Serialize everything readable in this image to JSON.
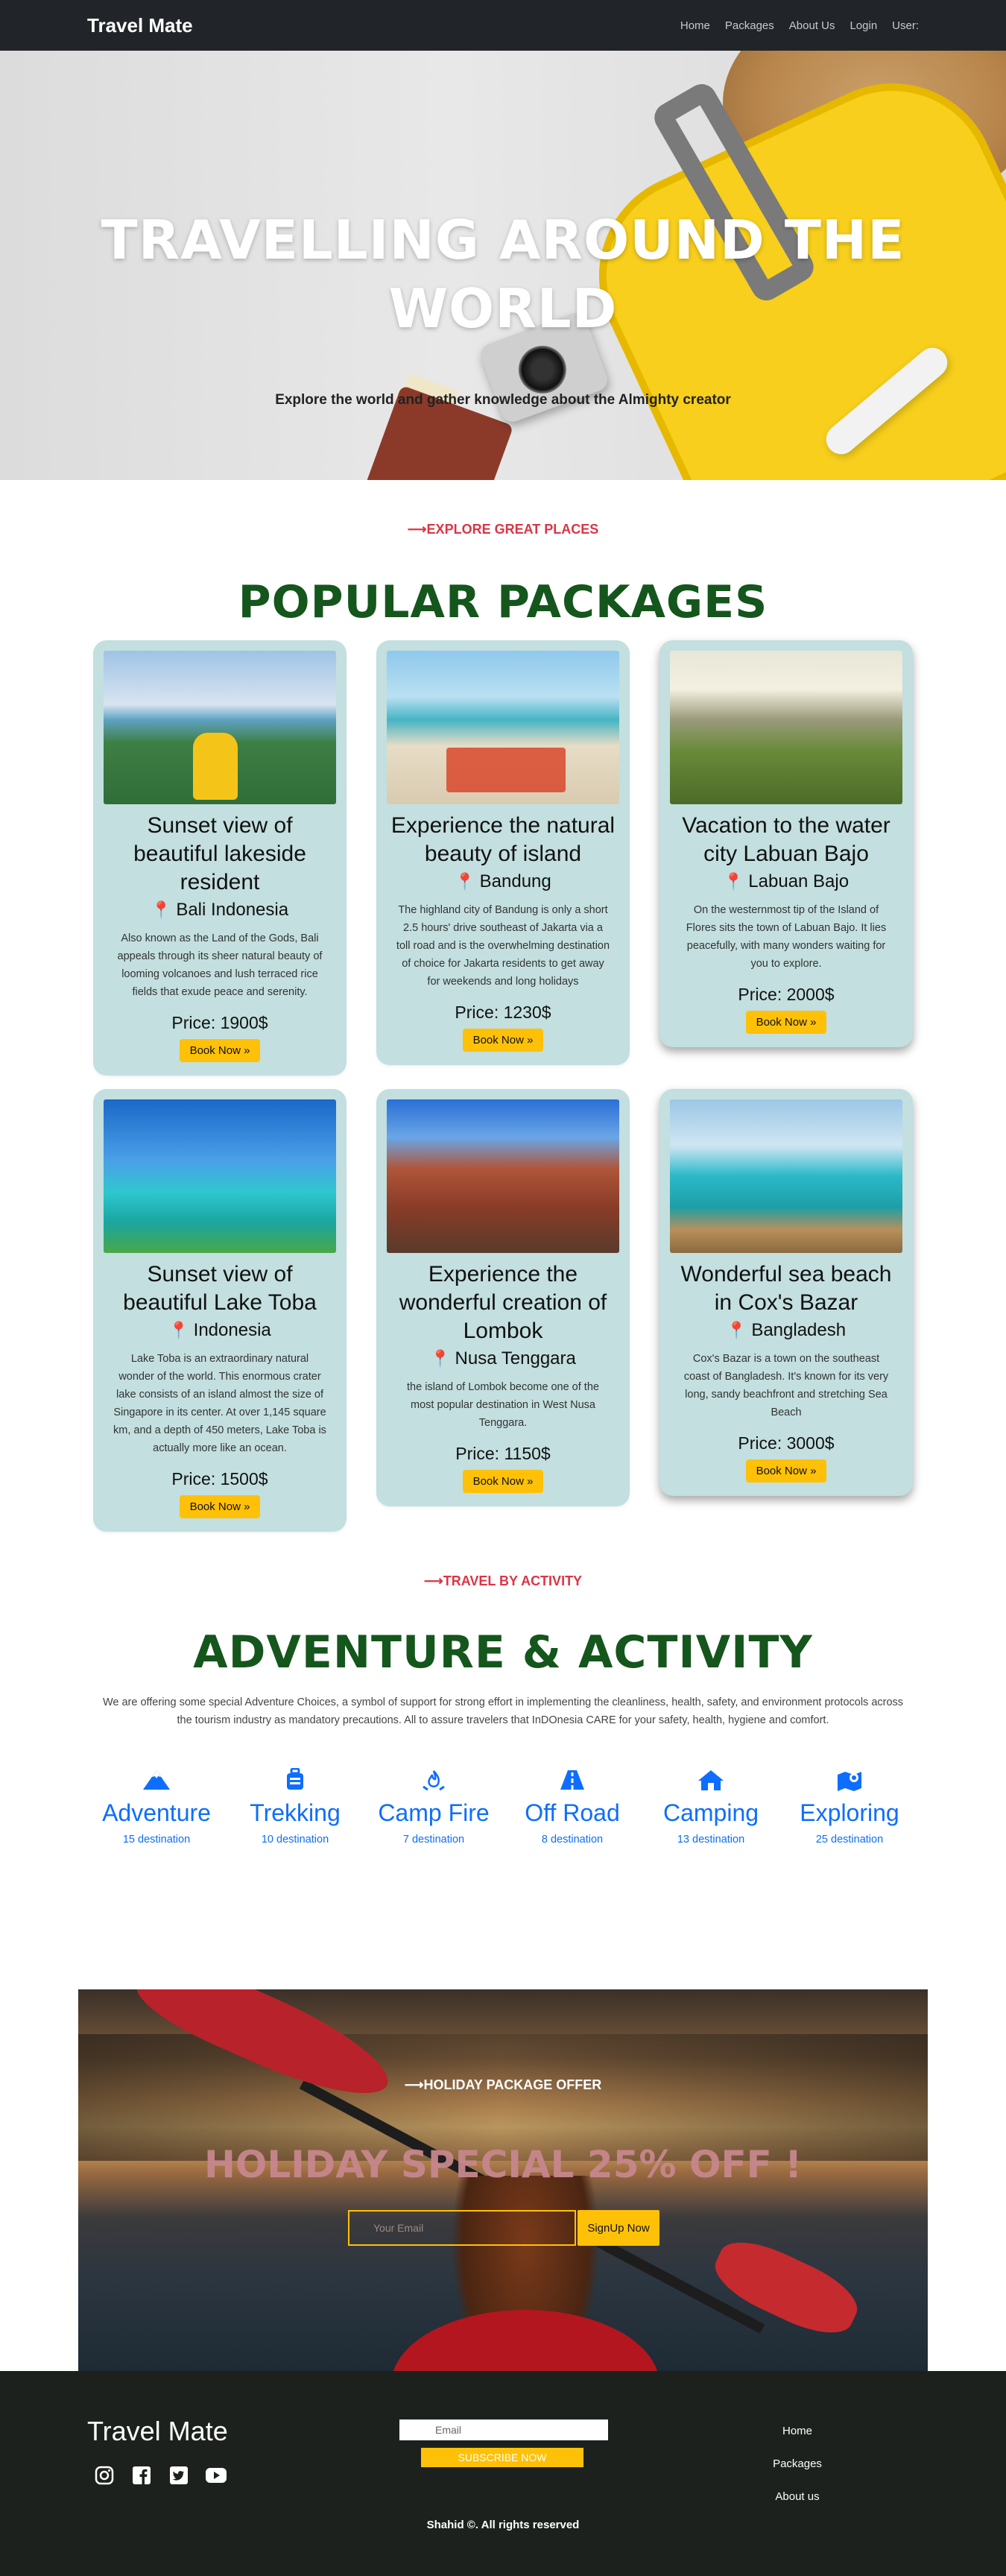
{
  "nav": {
    "brand": "Travel Mate",
    "links": [
      "Home",
      "Packages",
      "About Us",
      "Login",
      "User:"
    ]
  },
  "hero": {
    "title": "TRAVELLING AROUND THE WORLD",
    "subtitle": "Explore the world and gather knowledge about the Almighty creator"
  },
  "packages_section": {
    "kicker": "⟶EXPLORE GREAT PLACES",
    "title": "POPULAR PACKAGES",
    "cards": [
      {
        "title": "Sunset view of beautiful lakeside resident",
        "location": "Bali Indonesia",
        "description": "Also known as the Land of the Gods, Bali appeals through its sheer natural beauty of looming volcanoes and lush terraced rice fields that exude peace and serenity.",
        "price": "Price: 1900$",
        "button": "Book Now »"
      },
      {
        "title": "Experience the natural beauty of island",
        "location": "Bandung",
        "description": "The highland city of Bandung is only a short 2.5 hours' drive southeast of Jakarta via a toll road and is the overwhelming destination of choice for Jakarta residents to get away for weekends and long holidays",
        "price": "Price: 1230$",
        "button": "Book Now »"
      },
      {
        "title": "Vacation to the water city Labuan Bajo",
        "location": "Labuan Bajo",
        "description": "On the westernmost tip of the Island of Flores sits the town of Labuan Bajo. It lies peacefully, with many wonders waiting for you to explore.",
        "price": "Price: 2000$",
        "button": "Book Now »"
      },
      {
        "title": "Sunset view of beautiful Lake Toba",
        "location": "Indonesia",
        "description": "Lake Toba is an extraordinary natural wonder of the world. This enormous crater lake consists of an island almost the size of Singapore in its center. At over 1,145 square km, and a depth of 450 meters, Lake Toba is actually more like an ocean.",
        "price": "Price: 1500$",
        "button": "Book Now »"
      },
      {
        "title": "Experience the wonderful creation of Lombok",
        "location": "Nusa Tenggara",
        "description": "the island of Lombok become one of the most popular destination in West Nusa Tenggara.",
        "price": "Price: 1150$",
        "button": "Book Now »"
      },
      {
        "title": "Wonderful sea beach in Cox's Bazar",
        "location": "Bangladesh",
        "description": "Cox's Bazar is a town on the southeast coast of Bangladesh. It's known for its very long, sandy beachfront and stretching Sea Beach",
        "price": "Price: 3000$",
        "button": "Book Now »"
      }
    ]
  },
  "activity_section": {
    "kicker": "⟶TRAVEL BY ACTIVITY",
    "title": "ADVENTURE & ACTIVITY",
    "description": "We are offering some special Adventure Choices, a symbol of support for strong effort in implementing the cleanliness, health, safety, and environment protocols across the tourism industry as mandatory precautions. All to assure travelers that InDOnesia CARE for your safety, health, hygiene and comfort.",
    "items": [
      {
        "name": "Adventure",
        "count": "15 destination",
        "icon": "mountain-icon"
      },
      {
        "name": "Trekking",
        "count": "10 destination",
        "icon": "suitcase-icon"
      },
      {
        "name": "Camp Fire",
        "count": "7 destination",
        "icon": "campfire-icon"
      },
      {
        "name": "Off Road",
        "count": "8 destination",
        "icon": "road-icon"
      },
      {
        "name": "Camping",
        "count": "13 destination",
        "icon": "home-icon"
      },
      {
        "name": "Exploring",
        "count": "25 destination",
        "icon": "map-icon"
      }
    ]
  },
  "offer": {
    "kicker": "⟶HOLIDAY PACKAGE OFFER",
    "title": "HOLIDAY SPECIAL 25% OFF !",
    "email_placeholder": "Your Email",
    "button": "SignUp Now"
  },
  "footer": {
    "brand": "Travel Mate",
    "email_placeholder": "Email",
    "subscribe": "SUBSCRIBE NOW",
    "links": [
      "Home",
      "Packages",
      "About us"
    ],
    "copyright": "Shahid ©. All rights reserved",
    "socials": [
      "instagram-icon",
      "facebook-icon",
      "twitter-icon",
      "youtube-icon"
    ]
  },
  "colors": {
    "navbar": "#212529",
    "accent_red": "#dc3545",
    "title_green": "#14561c",
    "card_bg": "#c3dfdf",
    "button_yellow": "#ffc107",
    "link_blue": "#0d6efd",
    "footer_bg": "#1c211d"
  }
}
